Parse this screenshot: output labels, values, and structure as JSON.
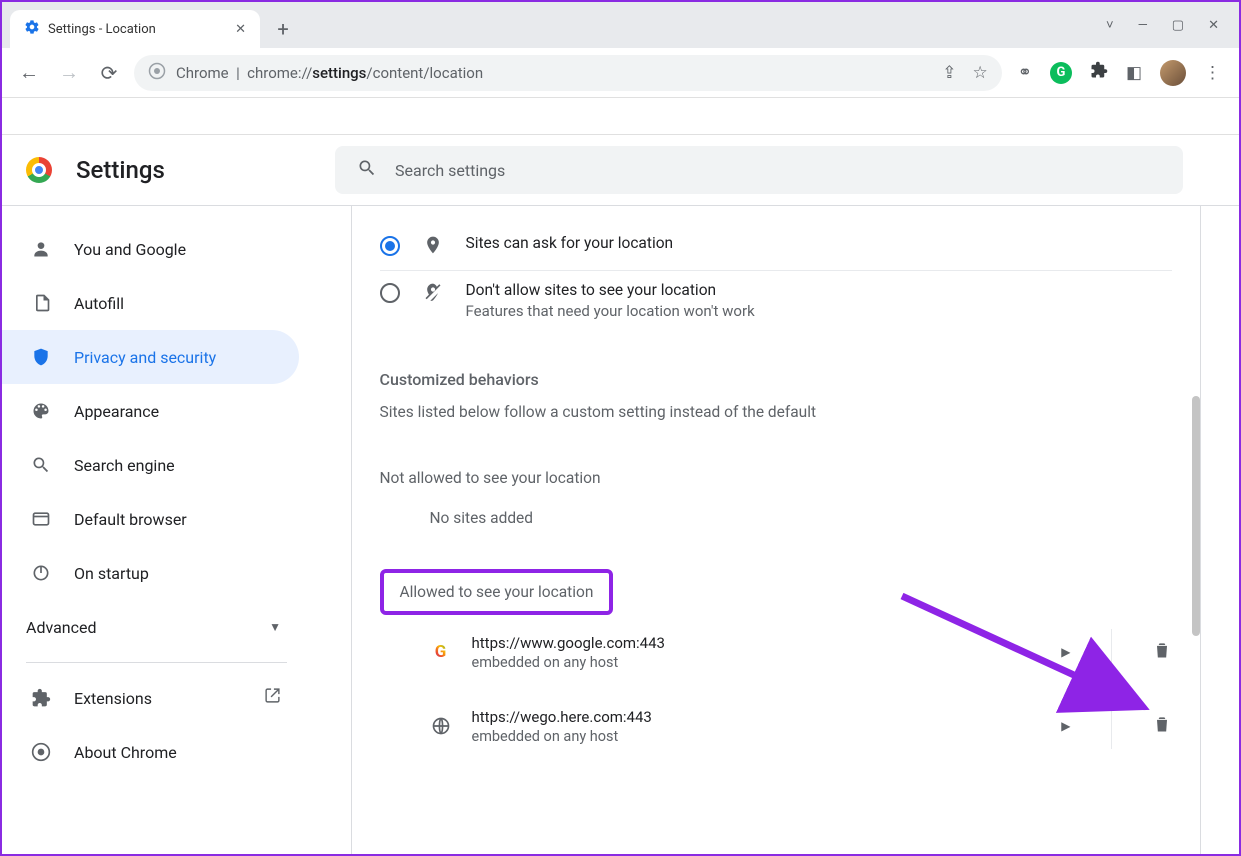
{
  "browser": {
    "tab": {
      "title": "Settings - Location"
    },
    "omnibox": {
      "prefix": "Chrome",
      "scheme": "chrome://",
      "bold": "settings",
      "rest": "/content/location"
    }
  },
  "header": {
    "title": "Settings",
    "search_placeholder": "Search settings"
  },
  "sidebar": {
    "items": [
      {
        "label": "You and Google",
        "icon": "user-icon"
      },
      {
        "label": "Autofill",
        "icon": "clipboard-icon"
      },
      {
        "label": "Privacy and security",
        "icon": "shield-icon",
        "active": true
      },
      {
        "label": "Appearance",
        "icon": "palette-icon"
      },
      {
        "label": "Search engine",
        "icon": "search-icon"
      },
      {
        "label": "Default browser",
        "icon": "browser-icon"
      },
      {
        "label": "On startup",
        "icon": "power-icon"
      }
    ],
    "advanced_label": "Advanced",
    "footer": [
      {
        "label": "Extensions",
        "icon": "puzzle-icon",
        "external": true
      },
      {
        "label": "About Chrome",
        "icon": "chrome-grey-icon"
      }
    ]
  },
  "content": {
    "radio_ask": {
      "title": "Sites can ask for your location"
    },
    "radio_block": {
      "title": "Don't allow sites to see your location",
      "subtitle": "Features that need your location won't work"
    },
    "customized_title": "Customized behaviors",
    "customized_desc": "Sites listed below follow a custom setting instead of the default",
    "not_allowed_title": "Not allowed to see your location",
    "no_sites": "No sites added",
    "allowed_title": "Allowed to see your location",
    "sites": [
      {
        "url": "https://www.google.com:443",
        "sub": "embedded on any host",
        "fav": "google"
      },
      {
        "url": "https://wego.here.com:443",
        "sub": "embedded on any host",
        "fav": "globe"
      }
    ]
  }
}
